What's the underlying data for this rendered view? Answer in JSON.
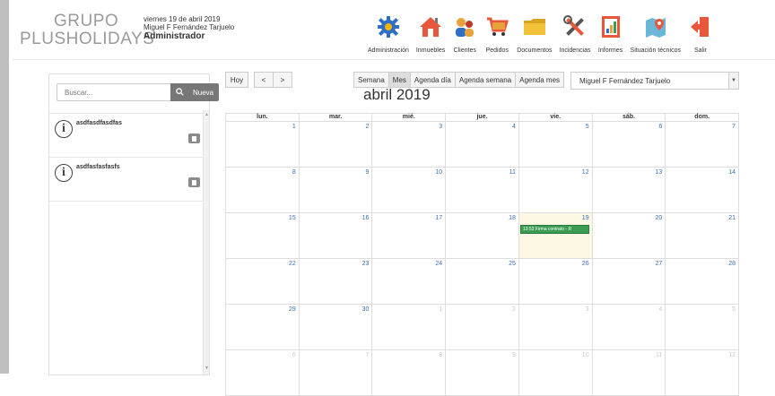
{
  "logo": {
    "line1": "GRUPO",
    "line2": "PLUSHOLIDAYS"
  },
  "header": {
    "date": "viernes 19 de abril 2019",
    "user": "Miguel F Fernández Tarjuelo",
    "role": "Administrador"
  },
  "nav": [
    {
      "label": "Administración",
      "icon": "gear-icon"
    },
    {
      "label": "Inmuebles",
      "icon": "house-icon"
    },
    {
      "label": "Clientes",
      "icon": "people-icon"
    },
    {
      "label": "Pedidos",
      "icon": "cart-icon"
    },
    {
      "label": "Documentos",
      "icon": "folder-icon"
    },
    {
      "label": "Incidencias",
      "icon": "tools-icon"
    },
    {
      "label": "Informes",
      "icon": "report-icon"
    },
    {
      "label": "Situación técnicos",
      "icon": "map-pin-icon"
    },
    {
      "label": "Salir",
      "icon": "exit-icon"
    }
  ],
  "sidebar": {
    "search_placeholder": "Buscar...",
    "new_label": "Nueva",
    "items": [
      {
        "title": "asdfasdfasdfas"
      },
      {
        "title": "asdfasfasfasfs"
      }
    ]
  },
  "calendar": {
    "today_label": "Hoy",
    "prev": "<",
    "next": ">",
    "views": [
      "Semana",
      "Mes",
      "Agenda día",
      "Agenda semana",
      "Agenda mes"
    ],
    "active_view": "Mes",
    "selected_user": "Miguel F Fernández Tarjuelo",
    "title": "abril 2019",
    "weekdays": [
      "lun.",
      "mar.",
      "mié.",
      "jue.",
      "vie.",
      "sáb.",
      "dom."
    ],
    "weeks": [
      [
        "1",
        "2",
        "3",
        "4",
        "5",
        "6",
        "7"
      ],
      [
        "8",
        "9",
        "10",
        "11",
        "12",
        "13",
        "14"
      ],
      [
        "15",
        "16",
        "17",
        "18",
        "19",
        "20",
        "21"
      ],
      [
        "22",
        "23",
        "24",
        "25",
        "26",
        "27",
        "28"
      ],
      [
        "29",
        "30",
        "1",
        "2",
        "3",
        "4",
        "5"
      ],
      [
        "6",
        "7",
        "8",
        "9",
        "10",
        "11",
        "12"
      ]
    ],
    "event": {
      "text": "13:53 Firma contrato - R"
    }
  },
  "colors": {
    "accent": "#3a6fb0",
    "event": "#3a9b53",
    "today": "#fcf8e3"
  }
}
